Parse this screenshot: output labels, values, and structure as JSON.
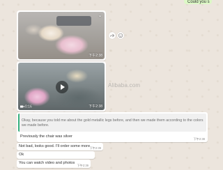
{
  "sent_bubble": {
    "text": "Could you s"
  },
  "photo": {
    "time": "下午2:38"
  },
  "video": {
    "duration": "0:16",
    "time": "下午2:38"
  },
  "watermark": "Alibaba.com",
  "reply": {
    "quote": "Okay, because you told me about the gold metallic legs before, and then we made them according to the colors we made before.",
    "text": "Previously the chair was silver",
    "time": "下午2:38"
  },
  "messages": [
    {
      "text": "Not bad, looks good. I'll order some more",
      "time": "下午2:39"
    },
    {
      "text": "Ok",
      "time": ""
    },
    {
      "text": "You can watch video and photos",
      "time": "下午2:39"
    }
  ],
  "icons": {
    "forward": "forward-icon",
    "emoji": "emoji-icon",
    "chevron": "chevron-down-icon",
    "play": "play-icon",
    "video_camera": "video-camera-icon"
  },
  "colors": {
    "chat_bg": "#ece5dd",
    "sent_bubble": "#dcf8c6",
    "quote_bar": "#35b07e"
  }
}
